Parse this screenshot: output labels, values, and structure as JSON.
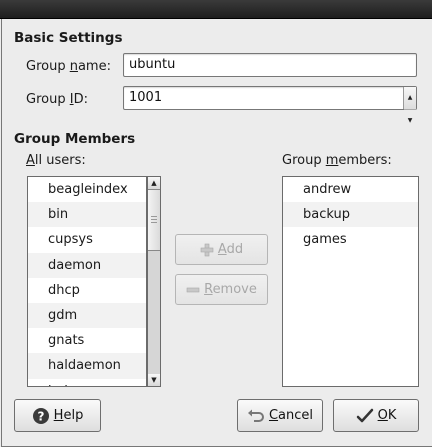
{
  "basic": {
    "title": "Basic Settings",
    "group_name_label_pre": "Group ",
    "group_name_label_u": "n",
    "group_name_label_post": "ame:",
    "group_name_value": "ubuntu",
    "group_id_label_pre": "Group ",
    "group_id_label_u": "I",
    "group_id_label_post": "D:",
    "group_id_value": "1001"
  },
  "members": {
    "title": "Group Members",
    "all_users_label_u": "A",
    "all_users_label_post": "ll users:",
    "group_members_label_pre": "Group ",
    "group_members_label_u": "m",
    "group_members_label_post": "embers:",
    "all_users": [
      "beagleindex",
      "bin",
      "cupsys",
      "daemon",
      "dhcp",
      "gdm",
      "gnats",
      "haldaemon",
      "hal"
    ],
    "group_members": [
      "andrew",
      "backup",
      "games"
    ],
    "all_users_scroll_fraction": 0.0
  },
  "buttons": {
    "add_u": "A",
    "add_post": "dd",
    "remove_u": "R",
    "remove_post": "emove",
    "help_u": "H",
    "help_post": "elp",
    "cancel_u": "C",
    "cancel_post": "ancel",
    "ok_u": "O",
    "ok_post": "K"
  },
  "colors": {
    "window_bg": "#ececec",
    "titlebar": "#2a2a2a",
    "list_bg": "#ffffff",
    "disabled_text": "#a8a8a8"
  }
}
